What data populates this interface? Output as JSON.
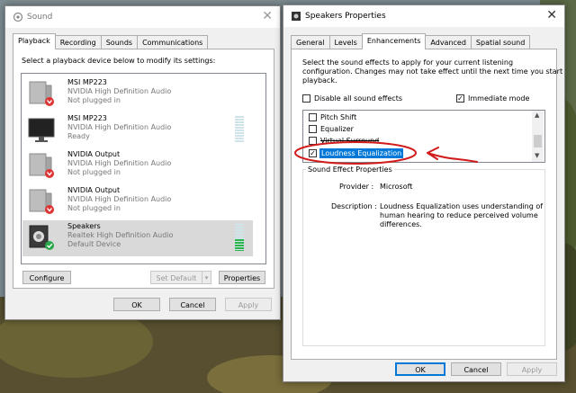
{
  "sound": {
    "title": "Sound",
    "tabs": [
      "Playback",
      "Recording",
      "Sounds",
      "Communications"
    ],
    "instruction": "Select a playback device below to modify its settings:",
    "devices": [
      {
        "name": "MSI MP223",
        "driver": "NVIDIA High Definition Audio",
        "status": "Not plugged in",
        "icon": "speaker-icon"
      },
      {
        "name": "MSI MP223",
        "driver": "NVIDIA High Definition Audio",
        "status": "Ready",
        "icon": "monitor-icon"
      },
      {
        "name": "NVIDIA Output",
        "driver": "NVIDIA High Definition Audio",
        "status": "Not plugged in",
        "icon": "speaker-icon"
      },
      {
        "name": "NVIDIA Output",
        "driver": "NVIDIA High Definition Audio",
        "status": "Not plugged in",
        "icon": "speaker-icon"
      },
      {
        "name": "Speakers",
        "driver": "Realtek High Definition Audio",
        "status": "Default Device",
        "icon": "speakers-icon"
      }
    ],
    "speakers_level": 0.45,
    "buttons": {
      "configure": "Configure",
      "set_default": "Set Default",
      "properties": "Properties",
      "ok": "OK",
      "cancel": "Cancel",
      "apply": "Apply"
    }
  },
  "props": {
    "title": "Speakers Properties",
    "tabs": [
      "General",
      "Levels",
      "Enhancements",
      "Advanced",
      "Spatial sound"
    ],
    "intro": [
      "Select the sound effects to apply for your current listening",
      "configuration. Changes may not take effect until the next time you start",
      "playback."
    ],
    "disable_all": "Disable all sound effects",
    "immediate_mode": "Immediate mode",
    "effects": [
      {
        "label": "Pitch Shift",
        "checked": false
      },
      {
        "label": "Equalizer",
        "checked": false
      },
      {
        "label": "Virtual Surround",
        "checked": false
      },
      {
        "label": "Loudness Equalization",
        "checked": true
      }
    ],
    "group_title": "Sound Effect Properties",
    "provider_label": "Provider :",
    "provider_value": "Microsoft",
    "description_label": "Description :",
    "description_lines": [
      "Loudness Equalization uses understanding of",
      "human hearing to reduce perceived volume",
      "differences."
    ],
    "buttons": {
      "ok": "OK",
      "cancel": "Cancel",
      "apply": "Apply"
    }
  },
  "colors": {
    "annotation": "#d11a1a",
    "selection": "#0078d7"
  }
}
